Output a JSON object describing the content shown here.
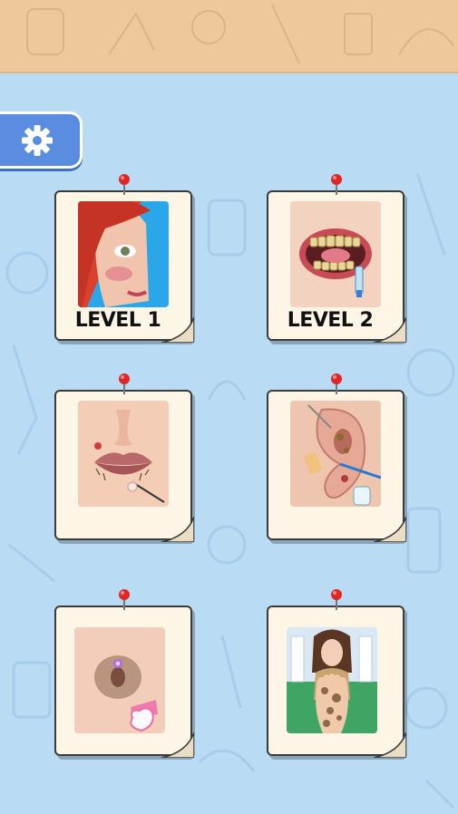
{
  "settings": {
    "icon": "gear-icon"
  },
  "levels": [
    {
      "label": "LEVEL 1",
      "art": "makeup-face-thumbnail"
    },
    {
      "label": "LEVEL 2",
      "art": "teeth-cleaning-thumbnail"
    },
    {
      "label": "",
      "art": "lip-care-thumbnail"
    },
    {
      "label": "",
      "art": "ear-cleaning-thumbnail"
    },
    {
      "label": "",
      "art": "navel-piercing-thumbnail"
    },
    {
      "label": "",
      "art": "foot-care-thumbnail"
    }
  ],
  "colors": {
    "background": "#b9dcf4",
    "banner": "#efc79a",
    "settings_button": "#5a8de0",
    "card_paper": "#fdf6e6",
    "pin": "#e02626"
  }
}
